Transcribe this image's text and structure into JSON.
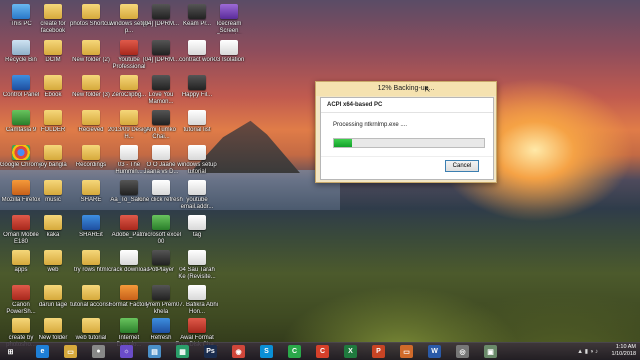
{
  "desktop": {
    "icons": [
      {
        "label": "This PC",
        "icon": "pc-icon",
        "style": "g-pc"
      },
      {
        "label": "Recycle Bin",
        "icon": "recycle-bin-icon",
        "style": "g-bin"
      },
      {
        "label": "Control Panel",
        "icon": "control-panel-icon",
        "style": "g-blue"
      },
      {
        "label": "Camtasia 9",
        "icon": "camtasia-icon",
        "style": "g-green"
      },
      {
        "label": "Google Chrome",
        "icon": "chrome-icon",
        "style": "g-chrome"
      },
      {
        "label": "Mozilla Firefox",
        "icon": "firefox-icon",
        "style": "g-orange"
      },
      {
        "label": "Oman Mobile E180",
        "icon": "modem-icon",
        "style": "g-red"
      },
      {
        "label": "apps",
        "icon": "folder-icon",
        "style": "g-folder"
      },
      {
        "label": "Canon PowerSh...",
        "icon": "canon-icon",
        "style": "g-red"
      },
      {
        "label": "create by photosho...",
        "icon": "folder-icon",
        "style": "g-folder"
      },
      {
        "label": "create for facebook",
        "icon": "folder-icon",
        "style": "g-folder"
      },
      {
        "label": "DCIM",
        "icon": "folder-icon",
        "style": "g-folder"
      },
      {
        "label": "Ebook",
        "icon": "folder-icon",
        "style": "g-folder"
      },
      {
        "label": "FOLDER",
        "icon": "folder-icon",
        "style": "g-folder"
      },
      {
        "label": "joy bangla",
        "icon": "folder-icon",
        "style": "g-folder"
      },
      {
        "label": "music",
        "icon": "folder-icon",
        "style": "g-folder"
      },
      {
        "label": "kaka",
        "icon": "folder-icon",
        "style": "g-folder"
      },
      {
        "label": "web",
        "icon": "folder-icon",
        "style": "g-folder"
      },
      {
        "label": "darun lage",
        "icon": "folder-icon",
        "style": "g-folder"
      },
      {
        "label": "New folder",
        "icon": "folder-icon",
        "style": "g-folder"
      },
      {
        "label": "photos Shortcut",
        "icon": "folder-icon",
        "style": "g-folder"
      },
      {
        "label": "New folder (2)",
        "icon": "folder-icon",
        "style": "g-folder"
      },
      {
        "label": "New folder (3)",
        "icon": "folder-icon",
        "style": "g-folder"
      },
      {
        "label": "Recieved",
        "icon": "folder-icon",
        "style": "g-folder"
      },
      {
        "label": "Recordings",
        "icon": "folder-icon",
        "style": "g-folder"
      },
      {
        "label": "SHARE",
        "icon": "folder-icon",
        "style": "g-folder"
      },
      {
        "label": "SHAREit",
        "icon": "shareit-icon",
        "style": "g-blue"
      },
      {
        "label": "try rows html",
        "icon": "folder-icon",
        "style": "g-folder"
      },
      {
        "label": "tutorial accoriss",
        "icon": "folder-icon",
        "style": "g-folder"
      },
      {
        "label": "web tutorial",
        "icon": "folder-icon",
        "style": "g-folder"
      },
      {
        "label": "windows setup p...",
        "icon": "folder-icon",
        "style": "g-folder"
      },
      {
        "label": "Youtube Professional",
        "icon": "youtube-icon",
        "style": "g-red"
      },
      {
        "label": "ZeroClipbg...",
        "icon": "folder-icon",
        "style": "g-folder"
      },
      {
        "label": "2013/09 Design H...",
        "icon": "folder-icon",
        "style": "g-folder"
      },
      {
        "label": "03 - The Hummin...",
        "icon": "music-file-icon",
        "style": "g-doc"
      },
      {
        "label": "Aa_To_Sahi...",
        "icon": "video-file-icon",
        "style": "g-dark"
      },
      {
        "label": "Adobe_Pat...",
        "icon": "adobe-icon",
        "style": "g-red"
      },
      {
        "label": "crack download",
        "icon": "doc-icon",
        "style": "g-doc"
      },
      {
        "label": "Format Factory",
        "icon": "format-factory-icon",
        "style": "g-orange"
      },
      {
        "label": "Internet Downlo...",
        "icon": "idm-icon",
        "style": "g-green"
      },
      {
        "label": "[04] [DPRM...",
        "icon": "video-file-icon",
        "style": "g-dark"
      },
      {
        "label": "[04] [DPRM...",
        "icon": "video-file-icon",
        "style": "g-dark"
      },
      {
        "label": "Love You Mamon...",
        "icon": "video-file-icon",
        "style": "g-dark"
      },
      {
        "label": "Ami Tumko Chai...",
        "icon": "video-file-icon",
        "style": "g-dark"
      },
      {
        "label": "O O Jaane Jaana vs D...",
        "icon": "music-file-icon",
        "style": "g-doc"
      },
      {
        "label": "one click refresh",
        "icon": "doc-icon",
        "style": "g-doc"
      },
      {
        "label": "microsoft excel 00",
        "icon": "excel-icon",
        "style": "g-green"
      },
      {
        "label": "PotPlayer",
        "icon": "potplayer-icon",
        "style": "g-dark"
      },
      {
        "label": "Prem Prem khela",
        "icon": "video-file-icon",
        "style": "g-dark"
      },
      {
        "label": "Refresh",
        "icon": "refresh-icon",
        "style": "g-blue"
      },
      {
        "label": "Keam Pr...",
        "icon": "video-file-icon",
        "style": "g-dark"
      },
      {
        "label": "contract work",
        "icon": "doc-icon",
        "style": "g-doc"
      },
      {
        "label": "Happy Fil...",
        "icon": "video-file-icon",
        "style": "g-dark"
      },
      {
        "label": "tutorial list",
        "icon": "doc-icon",
        "style": "g-doc"
      },
      {
        "label": "windows setup tutorial",
        "icon": "doc-icon",
        "style": "g-doc"
      },
      {
        "label": "youtube email.addr...",
        "icon": "doc-icon",
        "style": "g-doc"
      },
      {
        "label": "tag",
        "icon": "doc-icon",
        "style": "g-doc"
      },
      {
        "label": "04 Sau Tarah Ke (Revisite...",
        "icon": "music-file-icon",
        "style": "g-doc"
      },
      {
        "label": "07. Bafikra Abhi Hon...",
        "icon": "music-file-icon",
        "style": "g-doc"
      },
      {
        "label": "Awal Format Free Disk Cha...",
        "icon": "format-icon",
        "style": "g-red"
      },
      {
        "label": "Icecream Screen Recorder",
        "icon": "icecream-icon",
        "style": "g-purple"
      },
      {
        "label": "03 Isolation",
        "icon": "music-file-icon",
        "style": "g-doc"
      }
    ]
  },
  "dialog": {
    "title": "12% Backing-up...",
    "header": "ACPI x64-based PC",
    "processing": "Processing ntkrnlmp.exe ....",
    "progress": 0.12,
    "cancel_label": "Cancel"
  },
  "taskbar": {
    "apps": [
      {
        "icon": "internet-explorer-icon",
        "glyph": "e",
        "color": "#1e7fd6"
      },
      {
        "icon": "file-explorer-icon",
        "glyph": "▭",
        "color": "#d6a93c"
      },
      {
        "icon": "media-icon",
        "glyph": "●",
        "color": "#888"
      },
      {
        "icon": "settings-icon",
        "glyph": "☼",
        "color": "#6a4cc8"
      },
      {
        "icon": "clipboard-icon",
        "glyph": "▤",
        "color": "#4a8fc8"
      },
      {
        "icon": "store-icon",
        "glyph": "▦",
        "color": "#2a9e6a"
      },
      {
        "icon": "photoshop-icon",
        "glyph": "Ps",
        "color": "#1b2d4e"
      },
      {
        "icon": "chrome-icon",
        "glyph": "◉",
        "color": "#d0463a"
      },
      {
        "icon": "skype-icon",
        "glyph": "S",
        "color": "#0a8fd6"
      },
      {
        "icon": "camtasia-icon",
        "glyph": "C",
        "color": "#2aa84a"
      },
      {
        "icon": "camtasia-recorder-icon",
        "glyph": "C",
        "color": "#d6402a"
      },
      {
        "icon": "excel-icon",
        "glyph": "X",
        "color": "#1f7a3e"
      },
      {
        "icon": "powerpoint-icon",
        "glyph": "P",
        "color": "#c84424"
      },
      {
        "icon": "folder-icon",
        "glyph": "▭",
        "color": "#d06a2a"
      },
      {
        "icon": "word-icon",
        "glyph": "W",
        "color": "#2a5aa8"
      },
      {
        "icon": "dvd-icon",
        "glyph": "◎",
        "color": "#777"
      },
      {
        "icon": "backup-app-icon",
        "glyph": "▣",
        "color": "#6a8a6a"
      }
    ],
    "time": "1:10 AM",
    "date": "1/10/2018"
  }
}
